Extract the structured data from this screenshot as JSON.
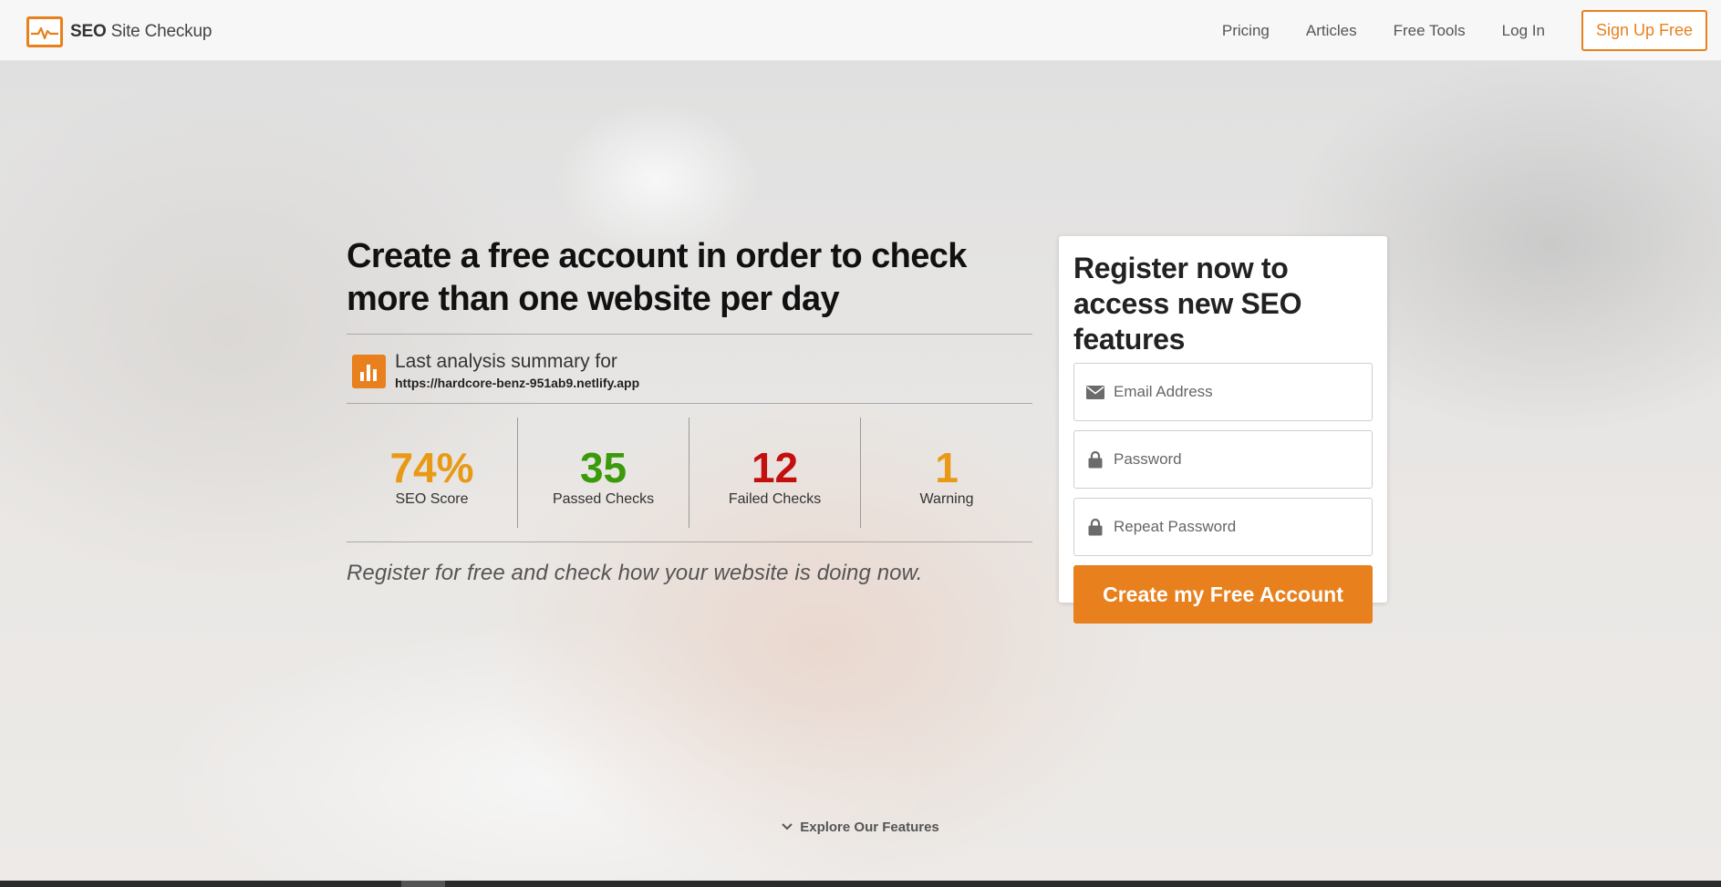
{
  "header": {
    "logo_bold": "SEO",
    "logo_rest": " Site Checkup",
    "nav": [
      "Pricing",
      "Articles",
      "Free Tools",
      "Log In"
    ],
    "signup_label": "Sign Up Free"
  },
  "main": {
    "headline": "Create a free account in order to check more than one website per day",
    "summary_label": "Last analysis summary for",
    "summary_url": "https://hardcore-benz-951ab9.netlify.app",
    "stats": [
      {
        "value": "74%",
        "label": "SEO Score",
        "color": "#e89a16"
      },
      {
        "value": "35",
        "label": "Passed Checks",
        "color": "#3a9a0a"
      },
      {
        "value": "12",
        "label": "Failed Checks",
        "color": "#c40f0f"
      },
      {
        "value": "1",
        "label": "Warning",
        "color": "#e89a16"
      }
    ],
    "tagline": "Register for free and check how your website is doing now."
  },
  "register": {
    "title": "Register now to access new SEO features",
    "email_placeholder": "Email Address",
    "password_placeholder": "Password",
    "repeat_password_placeholder": "Repeat Password",
    "submit_label": "Create my Free Account"
  },
  "explore": {
    "label": "Explore Our Features"
  },
  "colors": {
    "accent": "#e8801e"
  },
  "icons": [
    "logo-pulse-icon",
    "bar-chart-icon",
    "envelope-icon",
    "lock-icon",
    "chevron-down-icon"
  ]
}
